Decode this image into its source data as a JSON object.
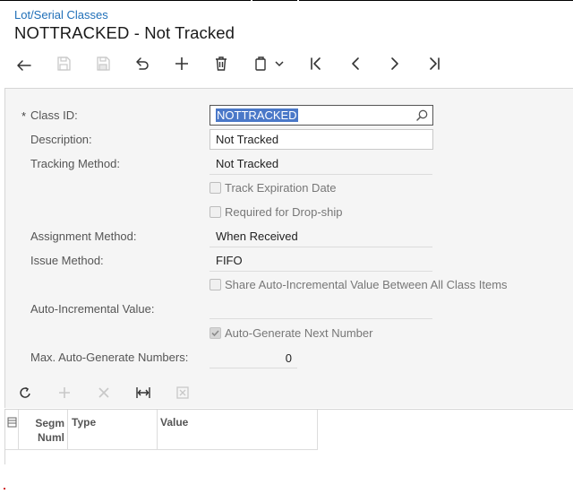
{
  "header": {
    "breadcrumb": "Lot/Serial Classes",
    "title": "NOTTRACKED - Not Tracked"
  },
  "toolbar": {
    "buttons": [
      {
        "name": "back-icon",
        "enabled": true
      },
      {
        "name": "save-icon",
        "enabled": false
      },
      {
        "name": "save-close-icon",
        "enabled": false
      },
      {
        "name": "undo-icon",
        "enabled": true
      },
      {
        "name": "add-icon",
        "enabled": true
      },
      {
        "name": "delete-icon",
        "enabled": true
      },
      {
        "name": "copy-paste-icon",
        "enabled": true
      },
      {
        "name": "first-record-icon",
        "enabled": true
      },
      {
        "name": "previous-record-icon",
        "enabled": true
      },
      {
        "name": "next-record-icon",
        "enabled": true
      },
      {
        "name": "last-record-icon",
        "enabled": true
      }
    ]
  },
  "form": {
    "required_marker": "*",
    "class_id": {
      "label": "Class ID:",
      "value": "NOTTRACKED"
    },
    "description": {
      "label": "Description:",
      "value": "Not Tracked"
    },
    "tracking_method": {
      "label": "Tracking Method:",
      "value": "Not Tracked"
    },
    "track_expiration_date": {
      "label": "Track Expiration Date",
      "checked": false
    },
    "required_for_dropship": {
      "label": "Required for Drop-ship",
      "checked": false
    },
    "assignment_method": {
      "label": "Assignment Method:",
      "value": "When Received"
    },
    "issue_method": {
      "label": "Issue Method:",
      "value": "FIFO"
    },
    "share_auto_incremental": {
      "label": "Share Auto-Incremental Value Between All Class Items",
      "checked": false
    },
    "auto_incremental_value": {
      "label": "Auto-Incremental Value:",
      "value": ""
    },
    "auto_generate_next_number": {
      "label": "Auto-Generate Next Number",
      "checked": true
    },
    "max_auto_generate_numbers": {
      "label": "Max. Auto-Generate Numbers:",
      "value": "0"
    }
  },
  "grid": {
    "toolbar": [
      "refresh-icon",
      "add-row-icon",
      "delete-row-icon",
      "fit-columns-icon",
      "export-excel-icon"
    ],
    "columns": [
      {
        "label_line1": "Segm",
        "label_line2": "Numl"
      },
      {
        "label": "Type"
      },
      {
        "label": "Value"
      }
    ]
  },
  "colors": {
    "link": "#1f6fb8",
    "selection": "#4a78c8",
    "panel_bg": "#f5f5f5"
  }
}
